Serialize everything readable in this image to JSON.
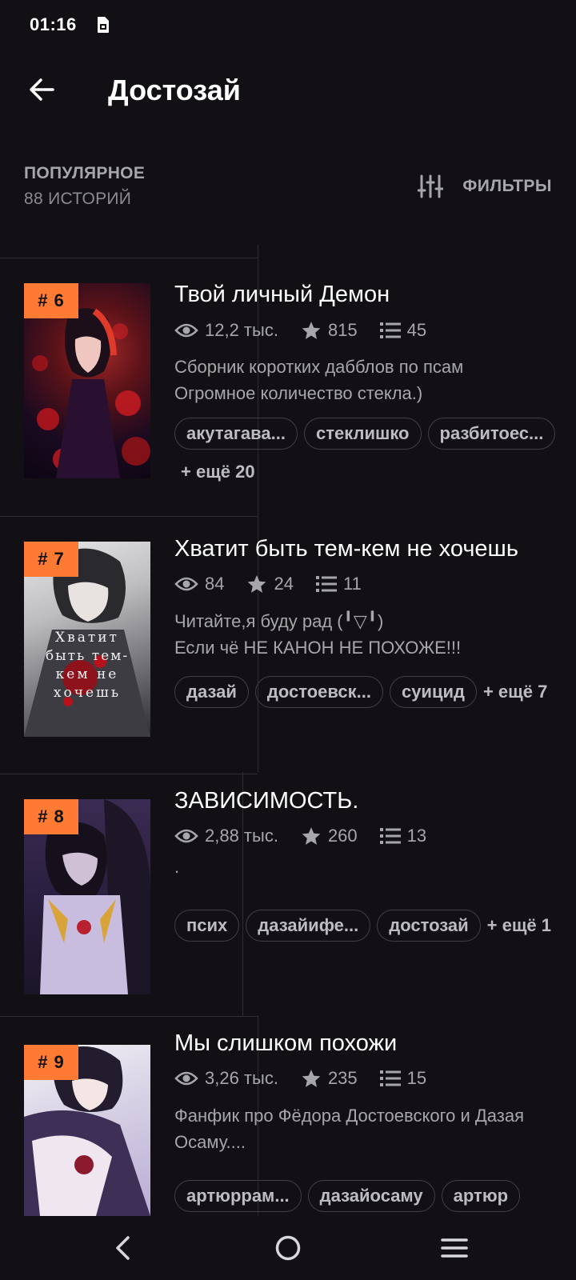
{
  "status_bar": {
    "time": "01:16",
    "sim_icon": "sim-card-icon"
  },
  "app_bar": {
    "title": "Достозай",
    "back_icon": "arrow-left-icon"
  },
  "section": {
    "sort_label": "ПОПУЛЯРНОЕ",
    "count_label": "88 ИСТОРИЙ",
    "filters_label": "ФИЛЬТРЫ",
    "filters_icon": "sliders-icon"
  },
  "stories": [
    {
      "rank": "# 6",
      "title": "Твой личный Демон",
      "views": "12,2 тыс.",
      "votes": "815",
      "parts": "45",
      "description": [
        "Сборник коротких дабблов по псам",
        "Огромное количество стекла.)"
      ],
      "tags": [
        "акутагава...",
        "стеклишко",
        "разбитоес..."
      ],
      "more": "+ ещё 20"
    },
    {
      "rank": "# 7",
      "title": "Хватит быть тем-кем не хочешь",
      "views": "84",
      "votes": "24",
      "parts": "11",
      "description": [
        "Читайте,я буду рад (╹▽╹)",
        "Если чё НЕ КАНОН НЕ ПОХОЖЕ!!!"
      ],
      "cover_text": "Хватит быть тем-кем не хочешь",
      "tags": [
        "дазай",
        "достоевск...",
        "суицид"
      ],
      "more": "+ ещё 7"
    },
    {
      "rank": "# 8",
      "title": "ЗАВИСИМОСТЬ.",
      "views": "2,88 тыс.",
      "votes": "260",
      "parts": "13",
      "description": [
        "."
      ],
      "tags": [
        "псих",
        "дазайифе...",
        "достозай"
      ],
      "more": "+ ещё 1"
    },
    {
      "rank": "# 9",
      "title": "Мы слишком похожи",
      "views": "3,26 тыс.",
      "votes": "235",
      "parts": "15",
      "description": [
        "Фанфик про Фёдора Достоевского и Дазая",
        "Осаму...."
      ],
      "tags": [
        "артюррам...",
        "дазайосаму",
        "артюр"
      ],
      "more": ""
    }
  ],
  "nav_bar": {
    "back_icon": "nav-back-icon",
    "home_icon": "nav-home-icon",
    "menu_icon": "nav-menu-icon"
  }
}
